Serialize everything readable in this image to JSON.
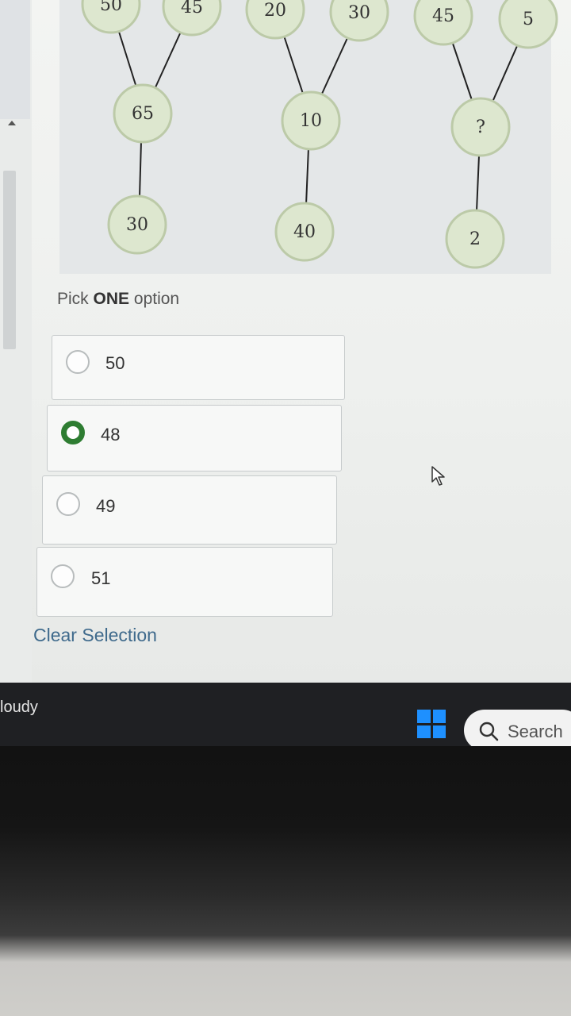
{
  "diagram": {
    "trees": [
      {
        "parents": [
          "50",
          "45"
        ],
        "middle": "65",
        "bottom": "30"
      },
      {
        "parents": [
          "20",
          "30"
        ],
        "middle": "10",
        "bottom": "40"
      },
      {
        "parents": [
          "45",
          "5"
        ],
        "middle": "?",
        "bottom": "2"
      }
    ]
  },
  "question": {
    "prompt_prefix": "Pick",
    "prompt_bold": "ONE",
    "prompt_suffix": "option",
    "options": [
      {
        "label": "50",
        "selected": false
      },
      {
        "label": "48",
        "selected": true
      },
      {
        "label": "49",
        "selected": false
      },
      {
        "label": "51",
        "selected": false
      }
    ],
    "clear_label": "Clear Selection"
  },
  "taskbar": {
    "weather_text": "loudy",
    "search_label": "Search",
    "accent_color": "#1e90ff"
  },
  "colors": {
    "selected_radio": "#2e7d32",
    "node_fill": "#dde7cf",
    "clear_link": "#3f6a8c"
  }
}
